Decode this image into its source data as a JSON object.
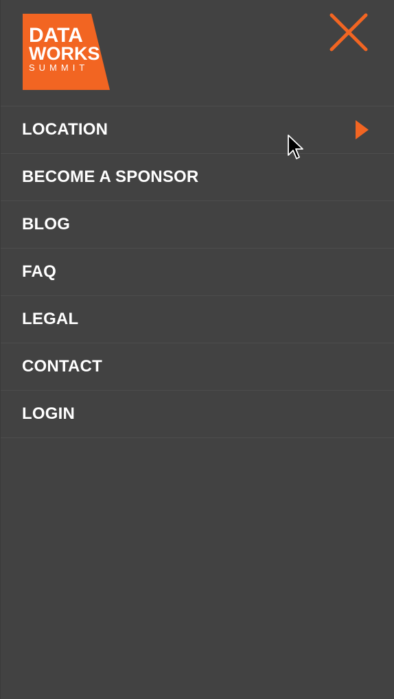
{
  "brand": {
    "logo_line1": "DATA",
    "logo_line2": "WORKS",
    "logo_line3": "SUMMIT",
    "accent_color": "#f26522",
    "background_color": "#424242"
  },
  "header": {
    "close_icon": "close-icon"
  },
  "menu": {
    "items": [
      {
        "label": "LOCATION",
        "has_submenu": true
      },
      {
        "label": "BECOME A SPONSOR"
      },
      {
        "label": "BLOG"
      },
      {
        "label": "FAQ"
      },
      {
        "label": "LEGAL"
      },
      {
        "label": "CONTACT"
      },
      {
        "label": "LOGIN"
      }
    ],
    "submenu_icon": "play-arrow-icon"
  },
  "cursor": {
    "icon": "mouse-pointer-icon"
  }
}
